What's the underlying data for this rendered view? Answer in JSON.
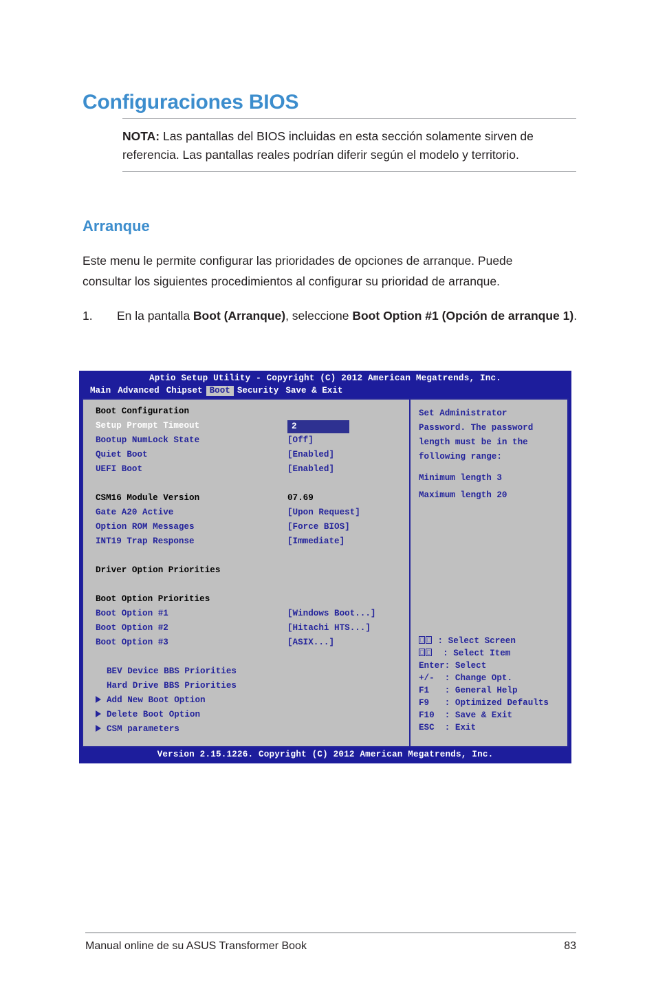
{
  "page": {
    "heading": "Configuraciones BIOS",
    "note": {
      "label": "NOTA:",
      "text": " Las pantallas del BIOS incluidas en esta sección solamente sirven de referencia. Las pantallas reales podrían diferir según el modelo y territorio."
    },
    "section_heading": "Arranque",
    "paragraph": "Este menu le permite configurar las prioridades de opciones de arranque. Puede consultar los siguientes procedimientos al configurar su prioridad de arranque.",
    "step": {
      "number": "1.",
      "part1": "En la pantalla ",
      "bold1": "Boot (Arranque)",
      "part2": ", seleccione ",
      "bold2": "Boot Option #1 (Opción de arranque 1)",
      "part3": "."
    },
    "footer": {
      "left": "Manual online de su ASUS Transformer Book",
      "page_number": "83"
    }
  },
  "bios": {
    "title": "Aptio Setup Utility - Copyright (C) 2012 American Megatrends, Inc.",
    "version_bar": "Version 2.15.1226. Copyright (C) 2012 American Megatrends, Inc.",
    "menu": [
      {
        "label": "Main",
        "active": false
      },
      {
        "label": "Advanced",
        "active": false
      },
      {
        "label": "Chipset",
        "active": false
      },
      {
        "label": "Boot",
        "active": true
      },
      {
        "label": "Security",
        "active": false
      },
      {
        "label": "Save & Exit",
        "active": false
      }
    ],
    "left_panel": {
      "group1_title": "Boot Configuration",
      "items1": [
        {
          "label": "Setup Prompt Timeout",
          "value": "2",
          "selected": true
        },
        {
          "label": "Bootup NumLock State",
          "value": "[Off]",
          "selected": false
        },
        {
          "label": "Quiet Boot",
          "value": "[Enabled]",
          "selected": false
        },
        {
          "label": "UEFI Boot",
          "value": "[Enabled]",
          "selected": false
        }
      ],
      "group2_title": "CSM16 Module Version",
      "group2_value": "07.69",
      "items2": [
        {
          "label": "Gate A20 Active",
          "value": "[Upon Request]"
        },
        {
          "label": "Option ROM Messages",
          "value": "[Force BIOS]"
        },
        {
          "label": "INT19 Trap Response",
          "value": "[Immediate]"
        }
      ],
      "group3_title": "Driver Option Priorities",
      "group4_title": "Boot Option Priorities",
      "items4": [
        {
          "label": "Boot Option #1",
          "value": "[Windows Boot...]"
        },
        {
          "label": "Boot Option #2",
          "value": "[Hitachi HTS...]"
        },
        {
          "label": "Boot Option #3",
          "value": "[ASIX...]"
        }
      ],
      "links": [
        {
          "label": "BEV Device BBS Priorities",
          "arrow": false
        },
        {
          "label": "Hard Drive BBS Priorities",
          "arrow": false
        },
        {
          "label": "Add New Boot Option",
          "arrow": true
        },
        {
          "label": "Delete Boot Option",
          "arrow": true
        },
        {
          "label": "CSM parameters",
          "arrow": true
        }
      ]
    },
    "right_panel": {
      "help": [
        "Set Administrator",
        "Password. The password",
        "length must be in the",
        "following range:"
      ],
      "help_min": "Minimum length 3",
      "help_max": "Maximum length 20",
      "keys": [
        {
          "glyph": "tofu2",
          "text": " : Select Screen"
        },
        {
          "glyph": "tofu2",
          "text": "  : Select Item"
        },
        {
          "glyph": "",
          "text": "Enter: Select"
        },
        {
          "glyph": "",
          "text": "+/-  : Change Opt."
        },
        {
          "glyph": "",
          "text": "F1   : General Help"
        },
        {
          "glyph": "",
          "text": "F9   : Optimized Defaults"
        },
        {
          "glyph": "",
          "text": "F10  : Save & Exit"
        },
        {
          "glyph": "",
          "text": "ESC  : Exit"
        }
      ]
    }
  },
  "colors": {
    "accent_blue": "#3c8dcd",
    "bios_blue": "#24249b",
    "bios_panel_grey": "#c0c0c0",
    "selection_blue": "#2e3191"
  }
}
